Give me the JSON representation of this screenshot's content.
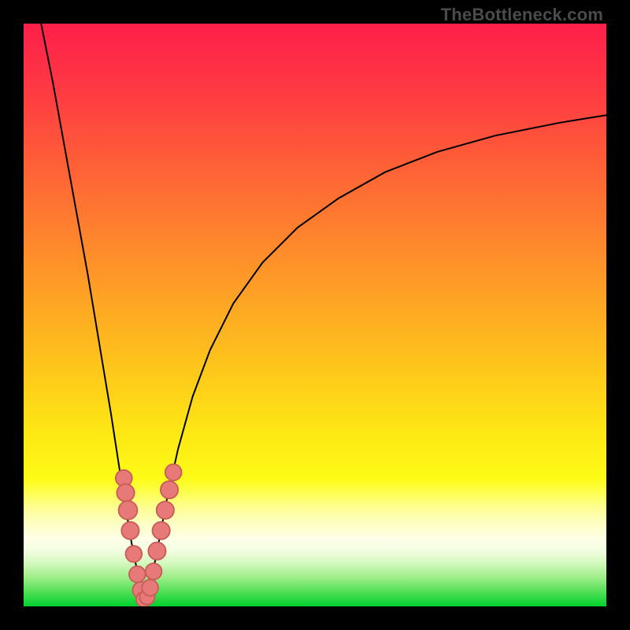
{
  "watermark": "TheBottleneck.com",
  "colors": {
    "frame": "#000000",
    "curve": "#000000",
    "dot_fill": "#e77a78",
    "dot_stroke": "#c95c58",
    "gradient_stops": [
      {
        "offset": 0.0,
        "color": "#fd1f4a"
      },
      {
        "offset": 0.12,
        "color": "#fe3b42"
      },
      {
        "offset": 0.25,
        "color": "#fe6236"
      },
      {
        "offset": 0.4,
        "color": "#fe8e2a"
      },
      {
        "offset": 0.55,
        "color": "#feba1e"
      },
      {
        "offset": 0.7,
        "color": "#fde714"
      },
      {
        "offset": 0.78,
        "color": "#fdfb16"
      },
      {
        "offset": 0.8,
        "color": "#fdfe43"
      },
      {
        "offset": 0.83,
        "color": "#fdfe92"
      },
      {
        "offset": 0.86,
        "color": "#fefec8"
      },
      {
        "offset": 0.885,
        "color": "#feffe8"
      },
      {
        "offset": 0.905,
        "color": "#f2fde0"
      },
      {
        "offset": 0.925,
        "color": "#d5f9bf"
      },
      {
        "offset": 0.95,
        "color": "#9eee8a"
      },
      {
        "offset": 0.975,
        "color": "#52df55"
      },
      {
        "offset": 1.0,
        "color": "#00d12e"
      }
    ]
  },
  "chart_data": {
    "type": "line",
    "title": "",
    "xlabel": "",
    "ylabel": "",
    "xlim": [
      0,
      100
    ],
    "ylim": [
      0,
      100
    ],
    "grid": false,
    "legend": false,
    "series": [
      {
        "name": "bottleneck-curve-left",
        "x": [
          3,
          5,
          7,
          9,
          11,
          13,
          15,
          17,
          18.5,
          19.5,
          20.2,
          20.8
        ],
        "y": [
          100,
          90,
          79,
          68,
          57,
          45,
          33,
          20,
          11,
          6,
          2.5,
          0.5
        ]
      },
      {
        "name": "bottleneck-curve-right",
        "x": [
          20.8,
          21.3,
          22,
          23,
          24.5,
          26.5,
          29,
          32,
          36,
          41,
          47,
          54,
          62,
          71,
          81,
          92,
          100
        ],
        "y": [
          0.5,
          2,
          5,
          10,
          18,
          27,
          36,
          44,
          52,
          59,
          65,
          70,
          74.5,
          78,
          80.8,
          83,
          84.3
        ]
      }
    ],
    "dots": {
      "name": "highlight-dots",
      "points": [
        {
          "x": 17.2,
          "y": 22.0,
          "r": 1.4
        },
        {
          "x": 17.5,
          "y": 19.5,
          "r": 1.5
        },
        {
          "x": 17.9,
          "y": 16.5,
          "r": 1.6
        },
        {
          "x": 18.3,
          "y": 13.0,
          "r": 1.5
        },
        {
          "x": 18.9,
          "y": 9.0,
          "r": 1.4
        },
        {
          "x": 19.5,
          "y": 5.5,
          "r": 1.4
        },
        {
          "x": 20.1,
          "y": 2.8,
          "r": 1.4
        },
        {
          "x": 20.6,
          "y": 1.2,
          "r": 1.3
        },
        {
          "x": 21.2,
          "y": 1.6,
          "r": 1.3
        },
        {
          "x": 21.7,
          "y": 3.2,
          "r": 1.4
        },
        {
          "x": 22.3,
          "y": 6.0,
          "r": 1.4
        },
        {
          "x": 22.9,
          "y": 9.5,
          "r": 1.5
        },
        {
          "x": 23.6,
          "y": 13.0,
          "r": 1.5
        },
        {
          "x": 24.3,
          "y": 16.5,
          "r": 1.5
        },
        {
          "x": 25.0,
          "y": 20.0,
          "r": 1.5
        },
        {
          "x": 25.7,
          "y": 23.0,
          "r": 1.4
        }
      ]
    }
  }
}
